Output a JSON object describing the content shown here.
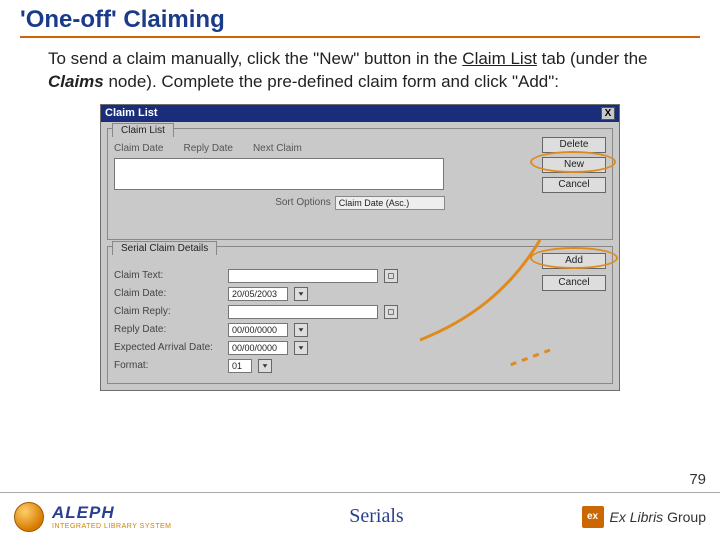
{
  "title": "'One-off' Claiming",
  "body": {
    "pre": "To send a claim manually, click the \"New\" button in the ",
    "claim_list": "Claim List",
    "mid1": " tab (under the ",
    "claims": "Claims",
    "mid2": " node). Complete the pre-defined claim form and click \"Add\":"
  },
  "win": {
    "title": "Claim List",
    "close": "X",
    "tab": "Claim List",
    "cols": {
      "c1": "Claim Date",
      "c2": "Reply Date",
      "c3": "Next Claim"
    },
    "btns": {
      "delete": "Delete",
      "new": "New",
      "cancel": "Cancel"
    },
    "sort_label": "Sort Options",
    "sort_value": "Claim Date (Asc.)",
    "details_tab": "Serial Claim Details",
    "fields": {
      "text": "Claim Text:",
      "date": "Claim Date:",
      "reply": "Claim Reply:",
      "replydate": "Reply Date:",
      "exp": "Expected Arrival Date:",
      "format": "Format:"
    },
    "values": {
      "date": "20/05/2003",
      "replydate": "00/00/0000",
      "exp": "00/00/0000",
      "format": "01"
    },
    "btns2": {
      "add": "Add",
      "cancel": "Cancel"
    }
  },
  "footer": {
    "aleph": "ALEPH",
    "aleph_sub": "INTEGRATED LIBRARY SYSTEM",
    "center": "Serials",
    "ex": "Ex Libris",
    "ex2": "Group"
  },
  "page": "79"
}
